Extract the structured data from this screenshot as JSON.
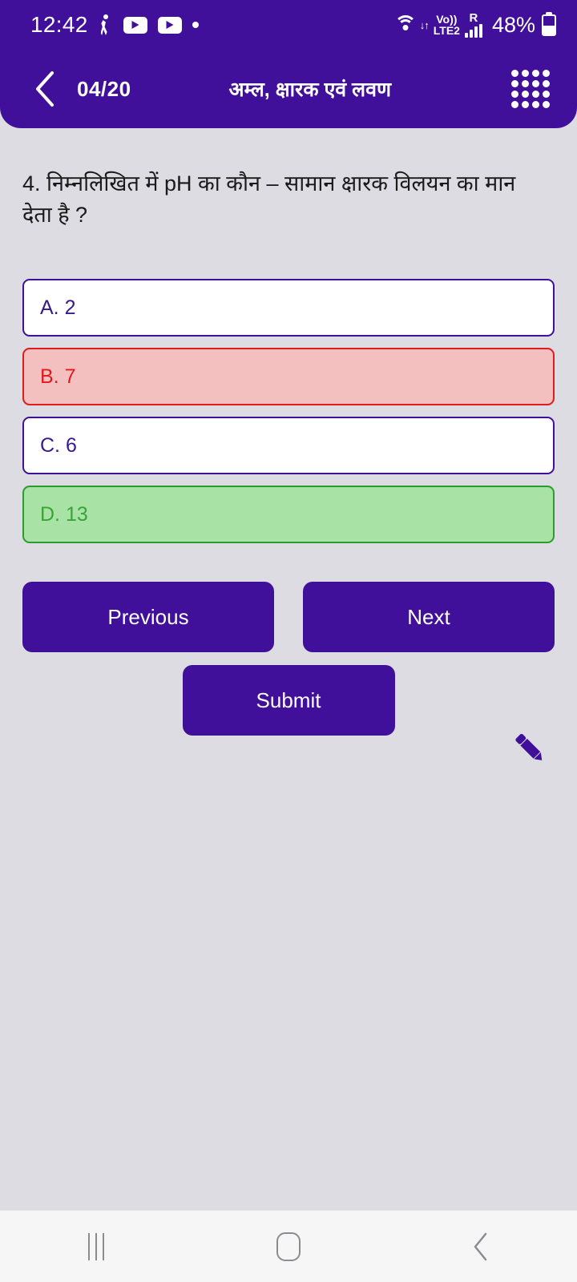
{
  "status_bar": {
    "time": "12:42",
    "battery_percent": "48%",
    "volte_top": "Vo))",
    "volte_bottom": "LTE2",
    "roaming": "R",
    "icons": [
      "walking-icon",
      "youtube-icon",
      "youtube-icon",
      "dot-icon",
      "wifi-icon",
      "volte-icon",
      "signal-bars-icon",
      "battery-icon"
    ]
  },
  "header": {
    "back_icon": "back-chevron-icon",
    "counter": "04/20",
    "title": "अम्ल, क्षारक एवं लवण",
    "grid_icon": "grid-menu-icon"
  },
  "question": {
    "text": "4. निम्नलिखित में pH का कौन – सामान क्षारक विलयन का मान देता है ?",
    "number": "4",
    "options": [
      {
        "label": "A. 2",
        "state": "neutral"
      },
      {
        "label": "B. 7",
        "state": "wrong"
      },
      {
        "label": "C. 6",
        "state": "neutral"
      },
      {
        "label": "D. 13",
        "state": "correct"
      }
    ]
  },
  "actions": {
    "previous": "Previous",
    "next": "Next",
    "submit": "Submit",
    "edit_icon": "pencil-icon"
  },
  "system_nav": {
    "recents_icon": "recents-icon",
    "home_icon": "home-icon",
    "back_icon": "back-icon"
  },
  "colors": {
    "primary_purple": "#41109a",
    "page_background": "#dcdce2",
    "wrong_bg": "#f4bfbf",
    "wrong_fg": "#e01b1b",
    "correct_bg": "#a8e2a4",
    "correct_fg": "#3aa33a",
    "option_text": "#3a1a8a"
  }
}
